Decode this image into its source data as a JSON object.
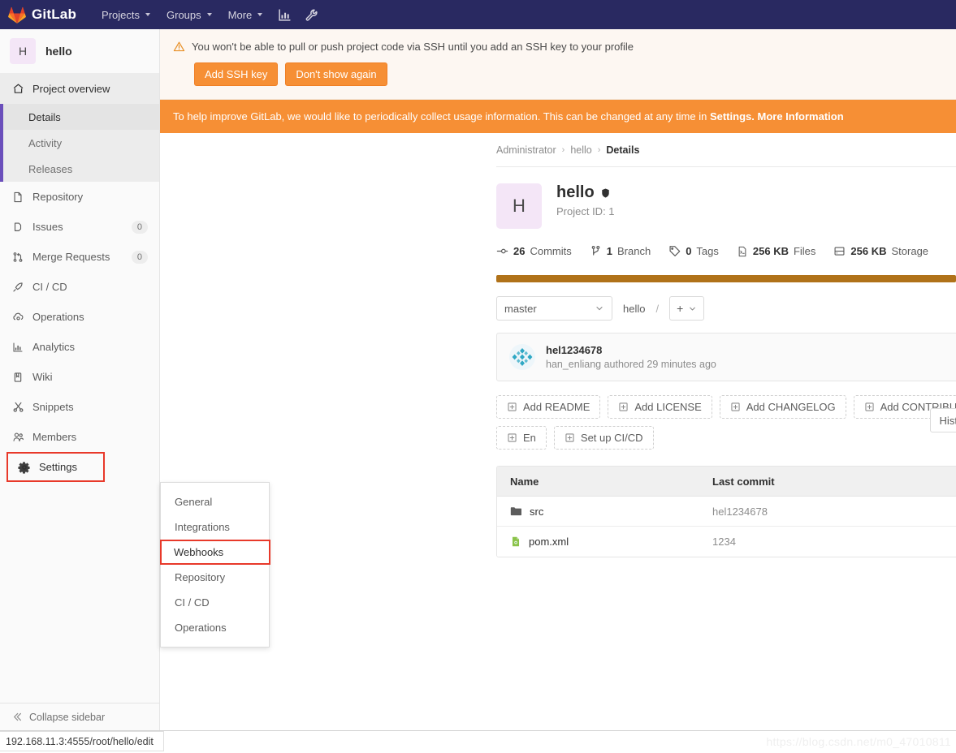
{
  "topnav": {
    "brand": "GitLab",
    "items": [
      {
        "label": "Projects",
        "icon": "chevron-down-icon"
      },
      {
        "label": "Groups",
        "icon": "chevron-down-icon"
      },
      {
        "label": "More",
        "icon": "chevron-down-icon"
      }
    ],
    "icons": [
      {
        "name": "activity-chart-icon"
      },
      {
        "name": "wrench-icon"
      }
    ],
    "bg_color": "#292961"
  },
  "sidebar": {
    "project": {
      "initial": "H",
      "name": "hello"
    },
    "overview": {
      "label": "Project overview",
      "icon": "home-icon",
      "sub_items": [
        {
          "label": "Details",
          "selected": true
        },
        {
          "label": "Activity",
          "selected": false
        },
        {
          "label": "Releases",
          "selected": false
        }
      ]
    },
    "items": [
      {
        "label": "Repository",
        "icon": "doc-icon",
        "count": ""
      },
      {
        "label": "Issues",
        "icon": "issue-icon",
        "count": "0"
      },
      {
        "label": "Merge Requests",
        "icon": "merge-icon",
        "count": "0"
      },
      {
        "label": "CI / CD",
        "icon": "rocket-icon",
        "count": ""
      },
      {
        "label": "Operations",
        "icon": "cloud-gear-icon",
        "count": ""
      },
      {
        "label": "Analytics",
        "icon": "bar-chart-icon",
        "count": ""
      },
      {
        "label": "Wiki",
        "icon": "book-icon",
        "count": ""
      },
      {
        "label": "Snippets",
        "icon": "scissors-icon",
        "count": ""
      },
      {
        "label": "Members",
        "icon": "people-icon",
        "count": ""
      },
      {
        "label": "Settings",
        "icon": "gear-icon",
        "count": "",
        "highlighted": true
      }
    ],
    "collapse": {
      "label": "Collapse sidebar",
      "icon": "collapse-icon"
    },
    "highlight_color": "#e8392a"
  },
  "settings_flyout": {
    "items": [
      {
        "label": "General",
        "highlighted": false
      },
      {
        "label": "Integrations",
        "highlighted": false
      },
      {
        "label": "Webhooks",
        "highlighted": true
      },
      {
        "label": "Repository",
        "highlighted": false
      },
      {
        "label": "CI / CD",
        "highlighted": false
      },
      {
        "label": "Operations",
        "highlighted": false
      }
    ]
  },
  "alerts": {
    "ssh": {
      "icon": "warning-triangle-icon",
      "message": "You won't be able to pull or push project code via SSH until you add an SSH key to your profile",
      "primary_button": "Add SSH key",
      "secondary_button": "Don't show again",
      "button_color": "#f68f35"
    },
    "usage": {
      "text_before": "To help improve GitLab, we would like to periodically collect usage information. This can be changed at any time in ",
      "link_settings": "Settings.",
      "link_more": "More Information",
      "bg_color": "#f68f35"
    }
  },
  "breadcrumb": {
    "items": [
      "Administrator",
      "hello"
    ],
    "current": "Details",
    "separator": "›"
  },
  "project": {
    "initial": "H",
    "name": "hello",
    "visibility_icon": "shield-icon",
    "id_label": "Project ID: 1",
    "stats": [
      {
        "icon": "commit-icon",
        "value": "26",
        "label": "Commits"
      },
      {
        "icon": "branch-icon",
        "value": "1",
        "label": "Branch"
      },
      {
        "icon": "tag-icon",
        "value": "0",
        "label": "Tags"
      },
      {
        "icon": "files-icon",
        "value": "256 KB",
        "label": "Files"
      },
      {
        "icon": "storage-icon",
        "value": "256 KB",
        "label": "Storage"
      }
    ],
    "language_bar_color": "#b07219"
  },
  "tree_controls": {
    "branch_select": "master",
    "path_root": "hello",
    "path_sep": "/",
    "add_button": "+",
    "history_button": "History"
  },
  "commit": {
    "title": "hel1234678",
    "meta": "han_enliang authored 29 minutes ago",
    "avatar_icon": "identicon-avatar"
  },
  "quick_actions": [
    {
      "label": "Add README",
      "icon": "plus-square-icon"
    },
    {
      "label": "Add LICENSE",
      "icon": "plus-square-icon"
    },
    {
      "label": "Add CHANGELOG",
      "icon": "plus-square-icon"
    },
    {
      "label": "Add CONTRIBUTING",
      "icon": "plus-square-icon"
    },
    {
      "label": "En",
      "icon": "plus-square-icon"
    },
    {
      "label": "Set up CI/CD",
      "icon": "plus-square-icon"
    }
  ],
  "file_table": {
    "columns": [
      "Name",
      "Last commit"
    ],
    "rows": [
      {
        "name": "src",
        "icon": "folder-icon",
        "last_commit": "hel1234678"
      },
      {
        "name": "pom.xml",
        "icon": "xml-file-icon",
        "last_commit": "1234"
      }
    ]
  },
  "statusbar": {
    "url": "192.168.11.3:4555/root/hello/edit",
    "watermark": "https://blog.csdn.net/m0_47010811"
  }
}
